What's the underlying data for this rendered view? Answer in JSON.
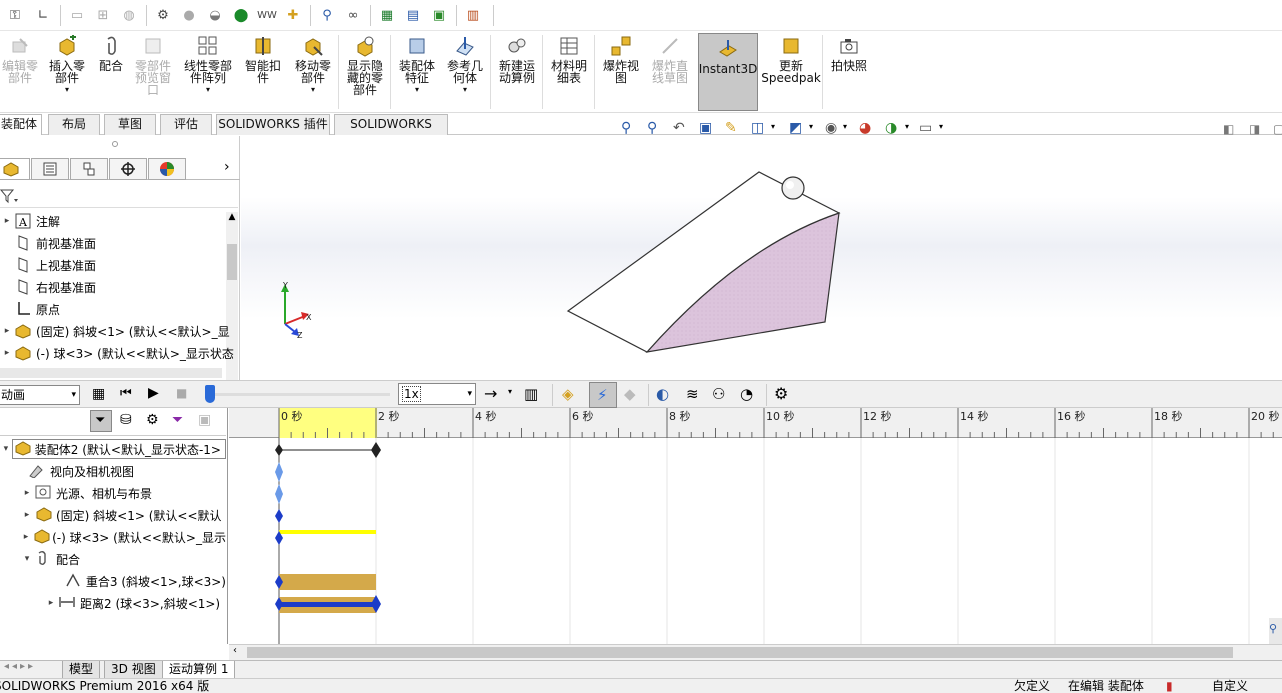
{
  "ribbon": {
    "edit_component": "编辑零\n部件",
    "insert_components": "插入零\n部件",
    "mate": "配合",
    "component_preview": "零部件\n预览窗\n口",
    "linear_pattern": "线性零部\n件阵列",
    "smart_fasteners": "智能扣\n件",
    "move_component": "移动零\n部件",
    "show_hidden": "显示隐\n藏的零\n部件",
    "assembly_features": "装配体\n特征",
    "reference_geometry": "参考几\n何体",
    "new_motion_study": "新建运\n动算例",
    "bom": "材料明\n细表",
    "exploded_view": "爆炸视\n图",
    "explode_line": "爆炸直\n线草图",
    "instant3d": "Instant3D",
    "speedpak": "更新\nSpeedpak",
    "snapshot": "拍快照"
  },
  "tabs": [
    "装配体",
    "布局",
    "草图",
    "评估",
    "SOLIDWORKS 插件",
    "SOLIDWORKS MBD"
  ],
  "feature_tree": {
    "items": [
      {
        "label": "注解"
      },
      {
        "label": "前视基准面"
      },
      {
        "label": "上视基准面"
      },
      {
        "label": "右视基准面"
      },
      {
        "label": "原点"
      },
      {
        "label": "(固定) 斜坡<1> (默认<<默认>_显"
      },
      {
        "label": "(-) 球<3> (默认<<默认>_显示状态"
      }
    ]
  },
  "triad": {
    "x": "X",
    "y": "Y",
    "z": "Z"
  },
  "motion": {
    "study_type": "动画",
    "speed": "1x"
  },
  "motion_tree": {
    "items": [
      {
        "label": "装配体2 (默认<默认_显示状态-1>"
      },
      {
        "label": "视向及相机视图"
      },
      {
        "label": "光源、相机与布景"
      },
      {
        "label": "(固定) 斜坡<1> (默认<<默认"
      },
      {
        "label": "(-) 球<3> (默认<<默认>_显示"
      },
      {
        "label": "配合"
      },
      {
        "label": "重合3 (斜坡<1>,球<3>)"
      },
      {
        "label": "距离2 (球<3>,斜坡<1>)"
      }
    ]
  },
  "timeline": {
    "ticks": [
      "0 秒",
      "2 秒",
      "4 秒",
      "6 秒",
      "8 秒",
      "10 秒",
      "12 秒",
      "14 秒",
      "16 秒",
      "18 秒",
      "20 秒"
    ]
  },
  "bottom_tabs": [
    "模型",
    "3D 视图",
    "运动算例 1"
  ],
  "status": {
    "app": "SOLIDWORKS Premium 2016 x64 版",
    "defined": "欠定义",
    "editing": "在编辑 装配体",
    "custom": "自定义"
  },
  "colors": {
    "selection_yellow": "#ffff80",
    "key_blue": "#1c3cc8",
    "bar_gold": "#d4a94a",
    "ramp_side": "#dcc4dc"
  }
}
